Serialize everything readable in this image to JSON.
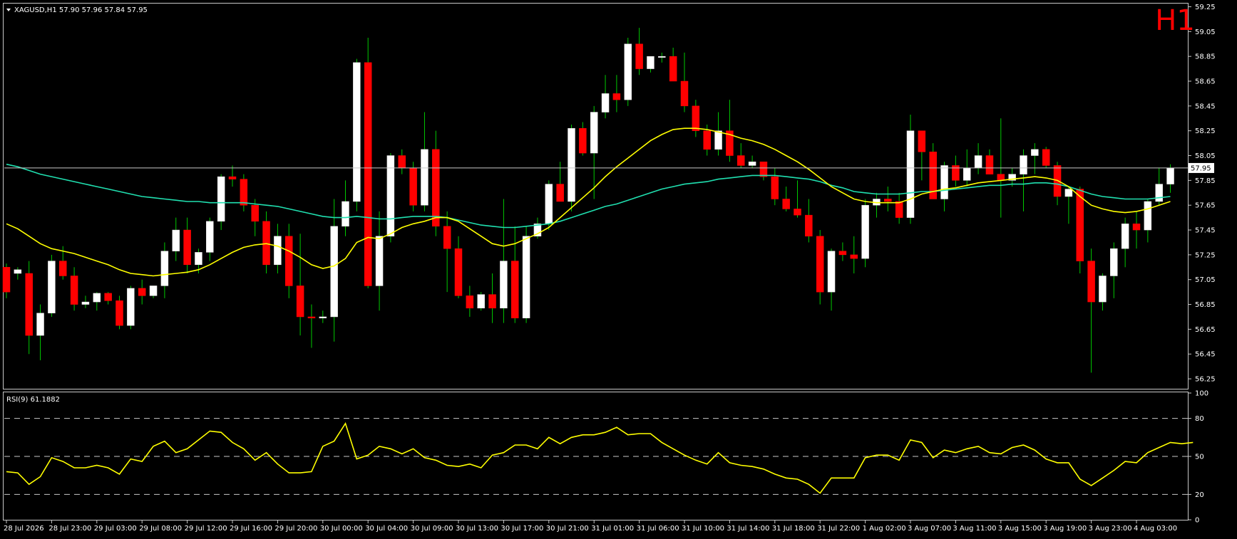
{
  "header": {
    "symbol_info": "XAGUSD,H1  57.90 57.96 57.84 57.95",
    "timeframe_badge": "H1",
    "rsi_label": "RSI(9) 61.1882"
  },
  "colors": {
    "background": "#000000",
    "bull_candle": "#FFFFFF",
    "bear_candle": "#FF0000",
    "wick": "#00C800",
    "ma_fast": "#FFFF00",
    "ma_slow": "#20E0B0",
    "rsi_line": "#FFFF00",
    "grid_dash": "#C8C8C8",
    "badge": "#FF0000",
    "price_tag_bg": "#FFFFFF"
  },
  "chart_data": [
    {
      "type": "candlestick",
      "title": "XAGUSD,H1  57.90 57.96 57.84 57.95",
      "y_axis_side": "right",
      "ylim": [
        56.17,
        59.27
      ],
      "y_ticks": [
        59.25,
        59.05,
        58.85,
        58.65,
        58.45,
        58.25,
        58.05,
        57.85,
        57.65,
        57.45,
        57.25,
        57.05,
        56.85,
        56.65,
        56.45,
        56.25
      ],
      "y_tick_labels": [
        "59.25",
        "59.05",
        "58.85",
        "58.65",
        "58.45",
        "58.25",
        "58.05",
        "57.85",
        "57.65",
        "57.45",
        "57.25",
        "57.05",
        "56.85",
        "56.65",
        "56.45",
        "56.25"
      ],
      "current_price": 57.95,
      "current_price_label": "57.95",
      "x_tick_labels": [
        "28 Jul 2026",
        "28 Jul 23:00",
        "29 Jul 03:00",
        "29 Jul 08:00",
        "29 Jul 12:00",
        "29 Jul 16:00",
        "29 Jul 20:00",
        "30 Jul 00:00",
        "30 Jul 04:00",
        "30 Jul 09:00",
        "30 Jul 13:00",
        "30 Jul 17:00",
        "30 Jul 21:00",
        "31 Jul 01:00",
        "31 Jul 06:00",
        "31 Jul 10:00",
        "31 Jul 14:00",
        "31 Jul 18:00",
        "31 Jul 22:00",
        "1 Aug 02:00",
        "3 Aug 07:00",
        "3 Aug 11:00",
        "3 Aug 15:00",
        "3 Aug 19:00",
        "3 Aug 23:00",
        "4 Aug 03:00"
      ],
      "x_tick_index": [
        0,
        4,
        8,
        12,
        16,
        20,
        24,
        28,
        32,
        36,
        40,
        44,
        48,
        52,
        56,
        60,
        64,
        68,
        72,
        76,
        80,
        84,
        88,
        92,
        96,
        100
      ],
      "candles": [
        [
          57.15,
          57.18,
          56.9,
          56.95
        ],
        [
          57.1,
          57.15,
          57.05,
          57.13
        ],
        [
          57.1,
          57.2,
          56.45,
          56.6
        ],
        [
          56.6,
          56.85,
          56.4,
          56.78
        ],
        [
          56.78,
          57.25,
          56.75,
          57.2
        ],
        [
          57.2,
          57.32,
          57.05,
          57.08
        ],
        [
          57.08,
          57.15,
          56.8,
          56.85
        ],
        [
          56.85,
          56.92,
          56.82,
          56.87
        ],
        [
          56.87,
          56.95,
          56.8,
          56.94
        ],
        [
          56.94,
          56.95,
          56.85,
          56.88
        ],
        [
          56.88,
          56.92,
          56.65,
          56.68
        ],
        [
          56.68,
          57.0,
          56.65,
          56.98
        ],
        [
          56.98,
          57.05,
          56.85,
          56.92
        ],
        [
          56.92,
          57.0,
          56.9,
          57.0
        ],
        [
          57.0,
          57.35,
          56.9,
          57.28
        ],
        [
          57.28,
          57.55,
          57.2,
          57.45
        ],
        [
          57.45,
          57.55,
          57.1,
          57.17
        ],
        [
          57.17,
          57.3,
          57.1,
          57.27
        ],
        [
          57.27,
          57.55,
          57.2,
          57.52
        ],
        [
          57.52,
          57.9,
          57.45,
          57.88
        ],
        [
          57.88,
          57.97,
          57.8,
          57.86
        ],
        [
          57.86,
          57.9,
          57.6,
          57.65
        ],
        [
          57.65,
          57.7,
          57.4,
          57.52
        ],
        [
          57.52,
          57.6,
          57.1,
          57.17
        ],
        [
          57.17,
          57.5,
          57.1,
          57.4
        ],
        [
          57.4,
          57.5,
          56.9,
          57.0
        ],
        [
          57.0,
          57.42,
          56.6,
          56.75
        ],
        [
          56.75,
          56.85,
          56.5,
          56.74
        ],
        [
          56.74,
          56.8,
          56.7,
          56.75
        ],
        [
          56.75,
          57.7,
          56.55,
          57.48
        ],
        [
          57.48,
          57.85,
          57.4,
          57.68
        ],
        [
          57.68,
          58.83,
          57.6,
          58.8
        ],
        [
          58.8,
          59.0,
          56.98,
          57.0
        ],
        [
          57.0,
          57.6,
          56.8,
          57.4
        ],
        [
          57.4,
          58.07,
          57.35,
          58.05
        ],
        [
          58.05,
          58.1,
          57.9,
          57.95
        ],
        [
          57.95,
          58.0,
          57.6,
          57.65
        ],
        [
          57.65,
          58.4,
          57.6,
          58.1
        ],
        [
          58.1,
          58.25,
          57.4,
          57.48
        ],
        [
          57.48,
          57.6,
          56.95,
          57.3
        ],
        [
          57.3,
          57.4,
          56.9,
          56.92
        ],
        [
          56.92,
          57.0,
          56.75,
          56.82
        ],
        [
          56.82,
          56.95,
          56.8,
          56.93
        ],
        [
          56.93,
          57.1,
          56.7,
          56.82
        ],
        [
          56.82,
          57.7,
          56.7,
          57.2
        ],
        [
          57.2,
          57.48,
          56.7,
          56.74
        ],
        [
          56.74,
          57.48,
          56.7,
          57.4
        ],
        [
          57.4,
          57.55,
          57.38,
          57.5
        ],
        [
          57.5,
          57.85,
          57.45,
          57.82
        ],
        [
          57.82,
          58.0,
          57.7,
          57.68
        ],
        [
          57.68,
          58.3,
          57.6,
          58.27
        ],
        [
          58.27,
          58.32,
          58.05,
          58.07
        ],
        [
          58.07,
          58.45,
          57.7,
          58.4
        ],
        [
          58.4,
          58.7,
          58.35,
          58.55
        ],
        [
          58.55,
          58.7,
          58.4,
          58.5
        ],
        [
          58.5,
          59.0,
          58.45,
          58.95
        ],
        [
          58.95,
          59.08,
          58.7,
          58.75
        ],
        [
          58.75,
          58.85,
          58.72,
          58.85
        ],
        [
          58.85,
          58.88,
          58.8,
          58.85
        ],
        [
          58.85,
          58.92,
          58.7,
          58.65
        ],
        [
          58.65,
          58.88,
          58.4,
          58.45
        ],
        [
          58.45,
          58.5,
          58.2,
          58.25
        ],
        [
          58.25,
          58.3,
          58.05,
          58.1
        ],
        [
          58.1,
          58.4,
          58.05,
          58.25
        ],
        [
          58.25,
          58.5,
          58.0,
          58.05
        ],
        [
          58.05,
          58.15,
          57.95,
          57.97
        ],
        [
          57.97,
          58.05,
          57.95,
          58.0
        ],
        [
          58.0,
          58.0,
          57.85,
          57.88
        ],
        [
          57.88,
          57.95,
          57.65,
          57.7
        ],
        [
          57.7,
          57.8,
          57.6,
          57.62
        ],
        [
          57.62,
          57.85,
          57.55,
          57.57
        ],
        [
          57.57,
          57.7,
          57.35,
          57.4
        ],
        [
          57.4,
          57.45,
          56.85,
          56.95
        ],
        [
          56.95,
          57.3,
          56.8,
          57.28
        ],
        [
          57.28,
          57.35,
          57.2,
          57.25
        ],
        [
          57.25,
          57.4,
          57.1,
          57.22
        ],
        [
          57.22,
          57.7,
          57.15,
          57.65
        ],
        [
          57.65,
          57.75,
          57.55,
          57.7
        ],
        [
          57.7,
          57.8,
          57.6,
          57.68
        ],
        [
          57.68,
          57.75,
          57.5,
          57.55
        ],
        [
          57.55,
          58.38,
          57.5,
          58.25
        ],
        [
          58.25,
          58.2,
          57.85,
          58.08
        ],
        [
          58.08,
          58.15,
          57.7,
          57.7
        ],
        [
          57.7,
          58.0,
          57.6,
          57.97
        ],
        [
          57.97,
          58.05,
          57.8,
          57.85
        ],
        [
          57.85,
          58.1,
          57.8,
          57.95
        ],
        [
          57.95,
          58.15,
          57.9,
          58.05
        ],
        [
          58.05,
          58.1,
          57.95,
          57.9
        ],
        [
          57.9,
          58.35,
          57.55,
          57.85
        ],
        [
          57.85,
          57.95,
          57.8,
          57.9
        ],
        [
          57.9,
          58.1,
          57.6,
          58.05
        ],
        [
          58.05,
          58.15,
          57.9,
          58.1
        ],
        [
          58.1,
          58.12,
          57.95,
          57.97
        ],
        [
          57.97,
          58.0,
          57.65,
          57.72
        ],
        [
          57.72,
          57.8,
          57.5,
          57.78
        ],
        [
          57.78,
          57.8,
          57.1,
          57.2
        ],
        [
          57.2,
          57.3,
          56.3,
          56.87
        ],
        [
          56.87,
          57.1,
          56.8,
          57.08
        ],
        [
          57.08,
          57.35,
          56.9,
          57.3
        ],
        [
          57.3,
          57.55,
          57.15,
          57.5
        ],
        [
          57.5,
          57.6,
          57.3,
          57.45
        ],
        [
          57.45,
          57.7,
          57.35,
          57.68
        ],
        [
          57.68,
          57.95,
          57.65,
          57.82
        ],
        [
          57.82,
          57.98,
          57.75,
          57.95
        ]
      ],
      "ma_fast": [
        57.5,
        57.46,
        57.4,
        57.34,
        57.3,
        57.28,
        57.26,
        57.23,
        57.2,
        57.17,
        57.13,
        57.1,
        57.09,
        57.08,
        57.09,
        57.1,
        57.11,
        57.13,
        57.17,
        57.22,
        57.27,
        57.31,
        57.33,
        57.34,
        57.32,
        57.28,
        57.23,
        57.17,
        57.14,
        57.16,
        57.22,
        57.35,
        57.39,
        57.38,
        57.42,
        57.47,
        57.5,
        57.52,
        57.55,
        57.55,
        57.52,
        57.46,
        57.4,
        57.34,
        57.32,
        57.34,
        57.38,
        57.42,
        57.47,
        57.55,
        57.63,
        57.71,
        57.79,
        57.88,
        57.96,
        58.03,
        58.1,
        58.17,
        58.22,
        58.26,
        58.27,
        58.27,
        58.26,
        58.24,
        58.22,
        58.19,
        58.17,
        58.14,
        58.1,
        58.05,
        58.0,
        57.94,
        57.87,
        57.8,
        57.75,
        57.7,
        57.68,
        57.67,
        57.67,
        57.67,
        57.7,
        57.74,
        57.76,
        57.78,
        57.79,
        57.81,
        57.83,
        57.84,
        57.85,
        57.86,
        57.87,
        57.88,
        57.87,
        57.85,
        57.8,
        57.72,
        57.65,
        57.62,
        57.6,
        57.59,
        57.6,
        57.62,
        57.65,
        57.68
      ],
      "ma_slow": [
        57.98,
        57.96,
        57.93,
        57.9,
        57.88,
        57.86,
        57.84,
        57.82,
        57.8,
        57.78,
        57.76,
        57.74,
        57.72,
        57.71,
        57.7,
        57.69,
        57.68,
        57.68,
        57.67,
        57.67,
        57.67,
        57.67,
        57.66,
        57.65,
        57.64,
        57.62,
        57.6,
        57.58,
        57.56,
        57.55,
        57.55,
        57.56,
        57.55,
        57.54,
        57.54,
        57.55,
        57.56,
        57.56,
        57.56,
        57.55,
        57.53,
        57.51,
        57.49,
        57.48,
        57.47,
        57.47,
        57.48,
        57.49,
        57.5,
        57.52,
        57.55,
        57.58,
        57.61,
        57.64,
        57.66,
        57.69,
        57.72,
        57.75,
        57.78,
        57.8,
        57.82,
        57.83,
        57.84,
        57.86,
        57.87,
        57.88,
        57.89,
        57.89,
        57.89,
        57.88,
        57.87,
        57.86,
        57.84,
        57.81,
        57.79,
        57.76,
        57.75,
        57.74,
        57.74,
        57.74,
        57.75,
        57.76,
        57.76,
        57.77,
        57.78,
        57.79,
        57.8,
        57.81,
        57.81,
        57.82,
        57.82,
        57.83,
        57.83,
        57.82,
        57.8,
        57.77,
        57.74,
        57.72,
        57.71,
        57.7,
        57.7,
        57.7,
        57.71,
        57.72
      ]
    },
    {
      "type": "line",
      "title": "RSI(9) 61.1882",
      "ylim": [
        0,
        100
      ],
      "y_ticks": [
        100,
        80,
        50,
        20,
        0
      ],
      "y_tick_labels": [
        "100",
        "80",
        "50",
        "20",
        "0"
      ],
      "dashed_levels": [
        80,
        50,
        20
      ],
      "series": [
        {
          "name": "RSI(9)",
          "values": [
            38,
            37,
            28,
            34,
            49,
            46,
            41,
            41,
            43,
            41,
            36,
            48,
            46,
            58,
            62,
            53,
            56,
            63,
            70,
            69,
            61,
            56,
            47,
            53,
            44,
            37,
            37,
            38,
            58,
            62,
            76,
            48,
            51,
            58,
            56,
            52,
            56,
            49,
            47,
            43,
            42,
            44,
            41,
            51,
            53,
            59,
            59,
            56,
            65,
            60,
            65,
            67,
            67,
            69,
            73,
            67,
            68,
            68,
            61,
            56,
            51,
            47,
            44,
            53,
            45,
            43,
            42,
            40,
            36,
            33,
            32,
            28,
            21,
            33,
            33,
            33,
            49,
            51,
            51,
            47,
            63,
            61,
            49,
            55,
            53,
            56,
            58,
            53,
            52,
            57,
            59,
            55,
            48,
            45,
            45,
            32,
            27,
            33,
            39,
            46,
            45,
            53,
            57,
            61,
            60,
            61
          ]
        }
      ]
    }
  ]
}
